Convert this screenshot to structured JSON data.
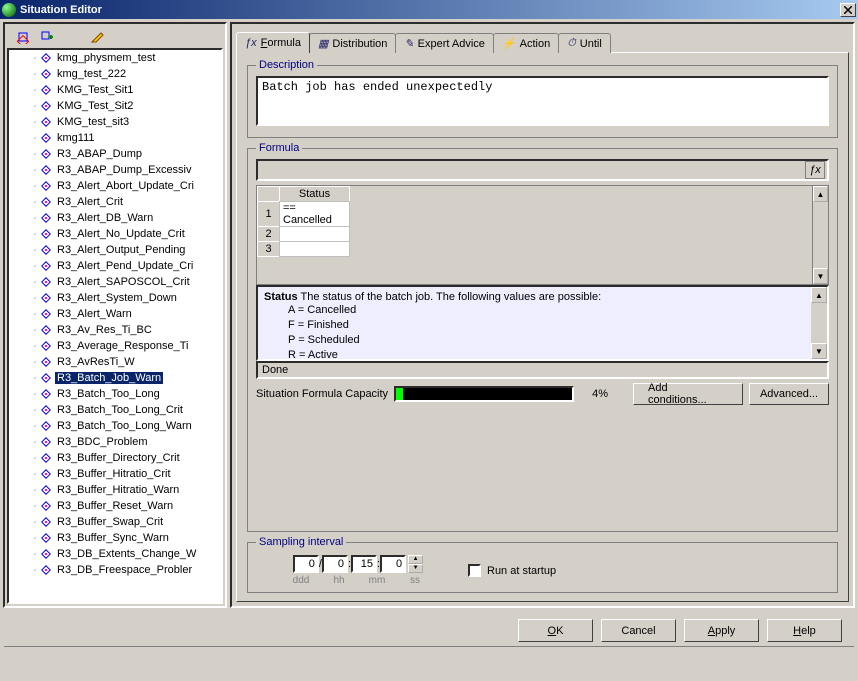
{
  "window": {
    "title": "Situation Editor"
  },
  "tree": {
    "items": [
      "kmg_physmem_test",
      "kmg_test_222",
      "KMG_Test_Sit1",
      "KMG_Test_Sit2",
      "KMG_test_sit3",
      "kmg111",
      "R3_ABAP_Dump",
      "R3_ABAP_Dump_Excessiv",
      "R3_Alert_Abort_Update_Cri",
      "R3_Alert_Crit",
      "R3_Alert_DB_Warn",
      "R3_Alert_No_Update_Crit",
      "R3_Alert_Output_Pending",
      "R3_Alert_Pend_Update_Cri",
      "R3_Alert_SAPOSCOL_Crit",
      "R3_Alert_System_Down",
      "R3_Alert_Warn",
      "R3_Av_Res_Ti_BC",
      "R3_Average_Response_Ti",
      "R3_AvResTi_W",
      "R3_Batch_Job_Warn",
      "R3_Batch_Too_Long",
      "R3_Batch_Too_Long_Crit",
      "R3_Batch_Too_Long_Warn",
      "R3_BDC_Problem",
      "R3_Buffer_Directory_Crit",
      "R3_Buffer_Hitratio_Crit",
      "R3_Buffer_Hitratio_Warn",
      "R3_Buffer_Reset_Warn",
      "R3_Buffer_Swap_Crit",
      "R3_Buffer_Sync_Warn",
      "R3_DB_Extents_Change_W",
      "R3_DB_Freespace_Probler"
    ],
    "selected": "R3_Batch_Job_Warn"
  },
  "tabs": {
    "items": [
      "Formula",
      "Distribution",
      "Expert Advice",
      "Action",
      "Until"
    ],
    "active": "Formula"
  },
  "description": {
    "label": "Description",
    "text": "Batch job has ended unexpectedly"
  },
  "formula": {
    "label": "Formula",
    "grid": {
      "header": "Status",
      "rows": [
        "== Cancelled",
        "",
        ""
      ]
    },
    "help": {
      "title": "Status",
      "lead": "The status of the batch job. The following values are possible:",
      "lines": [
        "A = Cancelled",
        "F = Finished",
        "P = Scheduled",
        "R = Active"
      ]
    },
    "done": "Done",
    "capacity": {
      "label": "Situation Formula Capacity",
      "pct": 4,
      "text": "4%"
    },
    "btn_add": "Add conditions...",
    "btn_adv": "Advanced..."
  },
  "sampling": {
    "label": "Sampling interval",
    "ddd": "0",
    "hh": "0",
    "mm": "15",
    "ss": "0",
    "lbl_ddd": "ddd",
    "lbl_hh": "hh",
    "lbl_mm": "mm",
    "lbl_ss": "ss",
    "run": "Run at startup"
  },
  "buttons": {
    "ok": "OK",
    "cancel": "Cancel",
    "apply": "Apply",
    "help": "Help"
  }
}
